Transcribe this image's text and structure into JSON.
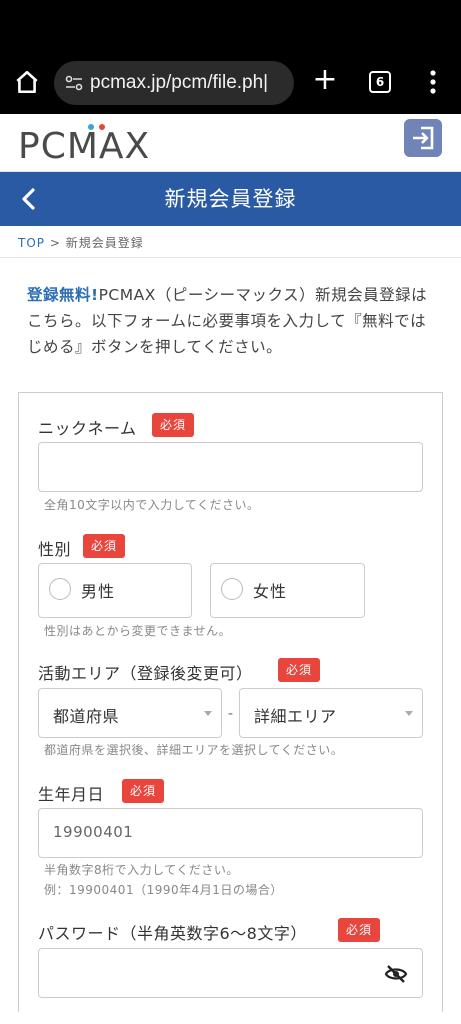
{
  "browser": {
    "url": "pcmax.jp/pcm/file.ph|",
    "tab_count": "6",
    "new_tab_label": "+"
  },
  "header": {
    "logo_text": "PCMAX"
  },
  "titlebar": {
    "title": "新規会員登録"
  },
  "breadcrumb": {
    "top": "TOP",
    "separator": " > ",
    "current": "新規会員登録"
  },
  "intro": {
    "free": "登録無料!",
    "text": "PCMAX（ピーシーマックス）新規会員登録はこちら。以下フォームに必要事項を入力して『無料ではじめる』ボタンを押してください。"
  },
  "form": {
    "required_label": "必須",
    "nickname": {
      "label": "ニックネーム",
      "value": "",
      "hint": "全角10文字以内で入力してください。"
    },
    "gender": {
      "label": "性別",
      "options": [
        "男性",
        "女性"
      ],
      "hint": "性別はあとから変更できません。"
    },
    "area": {
      "label": "活動エリア（登録後変更可）",
      "prefecture": "都道府県",
      "separator": "-",
      "detail": "詳細エリア",
      "hint": "都道府県を選択後、詳細エリアを選択してください。"
    },
    "birthday": {
      "label": "生年月日",
      "placeholder": "19900401",
      "hint1": "半角数字8桁で入力してください。",
      "hint2": "例：19900401（1990年4月1日の場合）"
    },
    "password": {
      "label": "パスワード（半角英数字6〜8文字）",
      "value": ""
    }
  },
  "colors": {
    "brand_blue": "#2b5aa5",
    "required_red": "#e8453c",
    "link_blue": "#2b6fb5"
  }
}
